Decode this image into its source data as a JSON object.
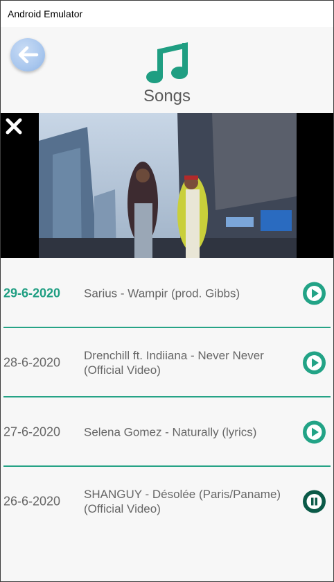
{
  "window": {
    "title": "Android Emulator"
  },
  "header": {
    "title": "Songs",
    "back_icon": "arrow-left-icon",
    "music_icon": "music-note-icon"
  },
  "player": {
    "close_icon": "close-icon"
  },
  "songs": [
    {
      "date": "29-6-2020",
      "title": "Sarius - Wampir (prod. Gibbs)",
      "state": "play",
      "active": true
    },
    {
      "date": "28-6-2020",
      "title": "Drenchill ft. Indiiana - Never Never (Official Video)",
      "state": "play",
      "active": false
    },
    {
      "date": "27-6-2020",
      "title": "Selena Gomez - Naturally (lyrics)",
      "state": "play",
      "active": false
    },
    {
      "date": "26-6-2020",
      "title": "SHANGUY - Désolée (Paris/Paname) (Official Video)",
      "state": "pause",
      "active": false
    }
  ],
  "colors": {
    "accent": "#22a386",
    "pause": "#0b5a48",
    "back_button": "#a9c7ee"
  }
}
